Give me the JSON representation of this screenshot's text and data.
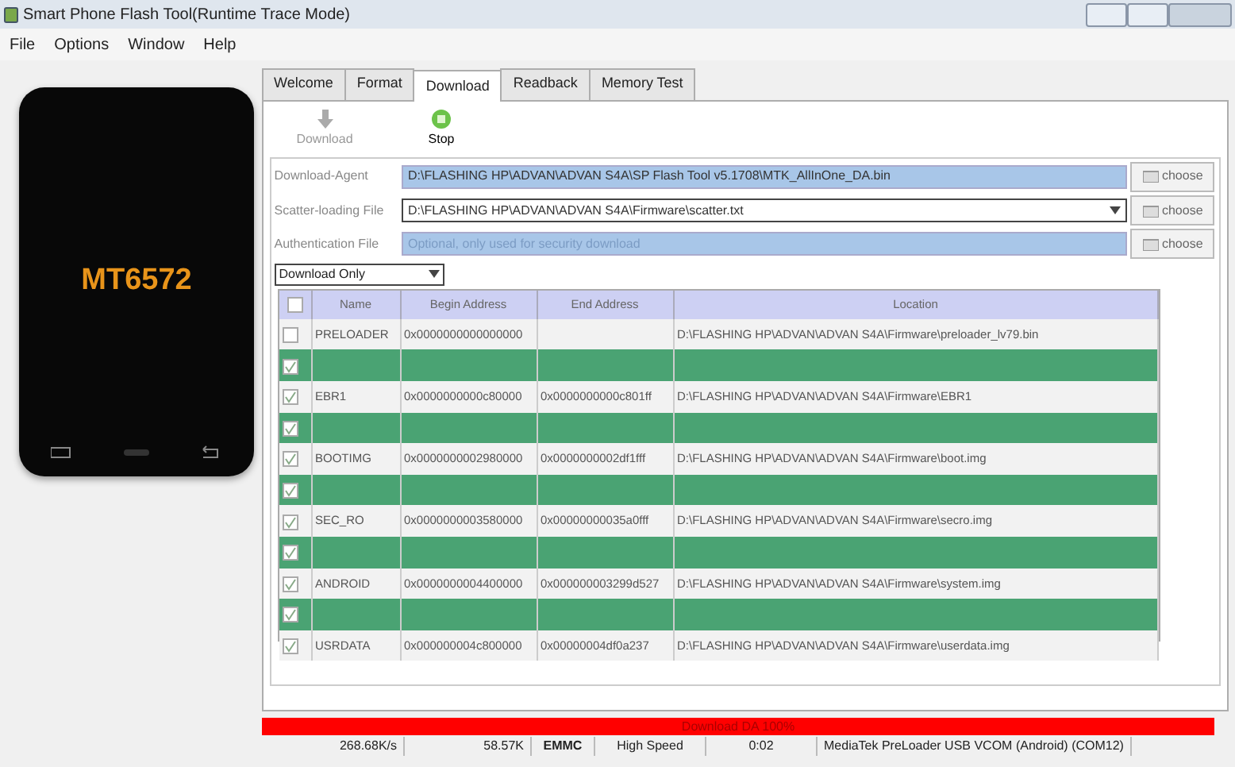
{
  "window": {
    "title": "Smart Phone Flash Tool(Runtime Trace Mode)"
  },
  "menu": [
    "File",
    "Options",
    "Window",
    "Help"
  ],
  "phone": {
    "chip": "MT6572"
  },
  "tabs": [
    {
      "label": "Welcome",
      "selected": false
    },
    {
      "label": "Format",
      "selected": false
    },
    {
      "label": "Download",
      "selected": true
    },
    {
      "label": "Readback",
      "selected": false
    },
    {
      "label": "Memory Test",
      "selected": false
    }
  ],
  "toolbar": [
    {
      "label": "Download",
      "kind": "download",
      "disabled": true
    },
    {
      "label": "Stop",
      "kind": "stop",
      "disabled": false
    }
  ],
  "files": [
    {
      "label": "Download-Agent",
      "value": "D:\\FLASHING HP\\ADVAN\\ADVAN S4A\\SP Flash Tool v5.1708\\MTK_AllInOne_DA.bin",
      "kind": "readonly",
      "button": "choose"
    },
    {
      "label": "Scatter-loading File",
      "value": "D:\\FLASHING HP\\ADVAN\\ADVAN S4A\\Firmware\\scatter.txt",
      "kind": "combo",
      "button": "choose"
    },
    {
      "label": "Authentication File",
      "placeholder": "Optional, only used for security download",
      "kind": "readonly",
      "button": "choose"
    }
  ],
  "mode": {
    "value": "Download Only"
  },
  "table": {
    "select_all": {
      "checked": false
    },
    "columns": [
      "Name",
      "Begin Address",
      "End Address",
      "Location"
    ],
    "rows": [
      {
        "checked": false,
        "highlighted": false,
        "name": "PRELOADER",
        "begin": "0x0000000000000000",
        "location": "D:\\FLASHING HP\\ADVAN\\ADVAN S4A\\Firmware\\preloader_lv79.bin"
      },
      {
        "checked": true,
        "highlighted": true
      },
      {
        "checked": true,
        "highlighted": false,
        "name": "EBR1",
        "begin": "0x0000000000c80000",
        "end": "0x0000000000c801ff",
        "location": "D:\\FLASHING HP\\ADVAN\\ADVAN S4A\\Firmware\\EBR1"
      },
      {
        "checked": true,
        "highlighted": true
      },
      {
        "checked": true,
        "highlighted": false,
        "name": "BOOTIMG",
        "begin": "0x0000000002980000",
        "end": "0x0000000002df1fff",
        "location": "D:\\FLASHING HP\\ADVAN\\ADVAN S4A\\Firmware\\boot.img"
      },
      {
        "checked": true,
        "highlighted": true
      },
      {
        "checked": true,
        "highlighted": false,
        "name": "SEC_RO",
        "begin": "0x0000000003580000",
        "end": "0x00000000035a0fff",
        "location": "D:\\FLASHING HP\\ADVAN\\ADVAN S4A\\Firmware\\secro.img"
      },
      {
        "checked": true,
        "highlighted": true
      },
      {
        "checked": true,
        "highlighted": false,
        "name": "ANDROID",
        "begin": "0x0000000004400000",
        "end": "0x000000003299d527",
        "location": "D:\\FLASHING HP\\ADVAN\\ADVAN S4A\\Firmware\\system.img"
      },
      {
        "checked": true,
        "highlighted": true
      },
      {
        "checked": true,
        "highlighted": false,
        "name": "USRDATA",
        "begin": "0x000000004c800000",
        "end": "0x00000004df0a237",
        "location": "D:\\FLASHING HP\\ADVAN\\ADVAN S4A\\Firmware\\userdata.img"
      }
    ]
  },
  "progress": {
    "label": "Download DA 100%",
    "level": 1
  },
  "status_bar": [
    {
      "text": "268.68K/s",
      "kind": "right"
    },
    {
      "text": "58.57K",
      "kind": "right"
    },
    {
      "text": "EMMC",
      "kind": "bold"
    },
    {
      "text": "High Speed",
      "kind": "center"
    },
    {
      "text": "0:02",
      "kind": "center"
    },
    {
      "text": "MediaTek PreLoader USB VCOM (Android) (COM12)",
      "kind": "left"
    }
  ]
}
